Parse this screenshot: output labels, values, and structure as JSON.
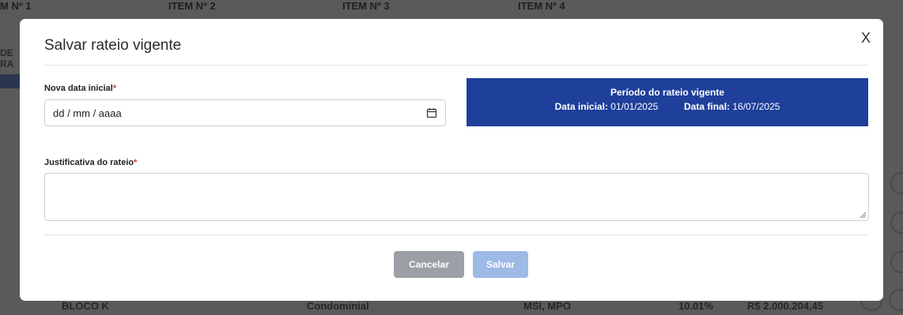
{
  "background": {
    "header_items": [
      "M Nº 1",
      "ITEM Nº 2",
      "ITEM Nº 3",
      "ITEM Nº 4"
    ],
    "left_text_1": "DE",
    "left_text_2": "RA",
    "footer_items": [
      "BLOCO K",
      "Condominial",
      "MSI, MPO",
      "10.01%",
      "R$ 2.000.204,45"
    ]
  },
  "modal": {
    "title": "Salvar rateio vigente",
    "close_label": "X",
    "start_date": {
      "label": "Nova data inicial",
      "required_mark": "*",
      "value": "dd / mm / aaaa",
      "icon": "calendar-icon"
    },
    "period": {
      "title": "Período do rateio vigente",
      "start_label": "Data inicial:",
      "start_value": "01/01/2025",
      "end_label": "Data final:",
      "end_value": "16/07/2025"
    },
    "justification": {
      "label": "Justificativa do rateio",
      "required_mark": "*",
      "value": ""
    },
    "buttons": {
      "cancel": "Cancelar",
      "save": "Salvar"
    }
  },
  "colors": {
    "overlay": "#5a5a5a",
    "period_bg": "#1e3f9a",
    "cancel_bg": "#9aa0a6",
    "save_bg": "#9db9e6",
    "required": "#dd3333"
  }
}
